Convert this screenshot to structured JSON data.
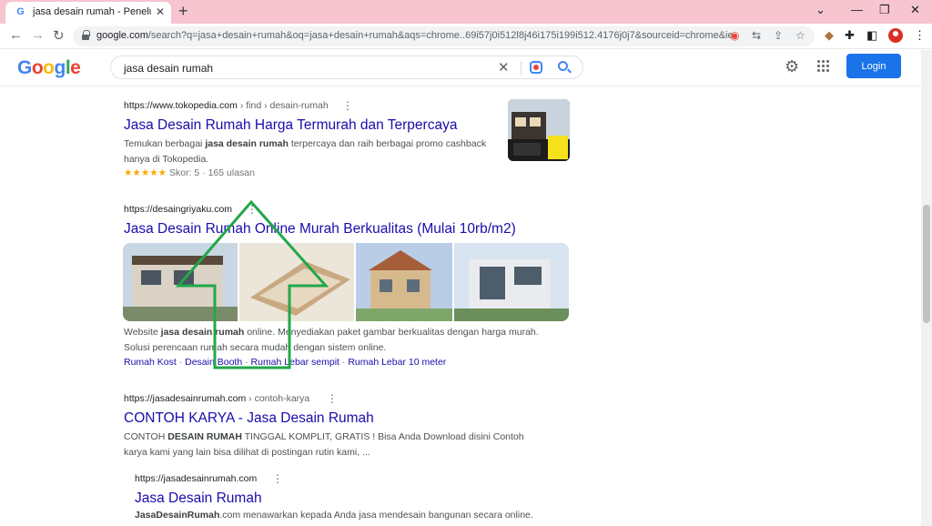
{
  "browser": {
    "tab_title": "jasa desain rumah - Penelusuran",
    "tab_close": "✕",
    "new_tab": "+",
    "url_host": "google.com",
    "url_path": "/search?q=jasa+desain+rumah&oq=jasa+desain+rumah&aqs=chrome..69i57j0i512l8j46i175i199i512.4176j0j7&sourceid=chrome&ie...",
    "win_min": "⌄",
    "win_minimize": "—",
    "win_restore": "❐",
    "win_close": "✕"
  },
  "google": {
    "logo_letters": [
      "G",
      "o",
      "o",
      "g",
      "l",
      "e"
    ],
    "logo_colors": [
      "#4285f4",
      "#ea4335",
      "#fbbc05",
      "#4285f4",
      "#34a853",
      "#ea4335"
    ],
    "query": "jasa desain rumah",
    "login_label": "Login"
  },
  "results": [
    {
      "cite": "https://www.tokopedia.com",
      "path": " › find › desain-rumah",
      "title": "Jasa Desain Rumah Harga Termurah dan Terpercaya",
      "snippet_a": "Temukan berbagai ",
      "snippet_b": "jasa desain rumah",
      "snippet_c": " terpercaya dan raih berbagai promo cashback",
      "snippet_d": "hanya di Tokopedia.",
      "stars": "★★★★★",
      "rating_text": " Skor: 5 · 165 ulasan"
    },
    {
      "cite": "https://desaingriyaku.com",
      "title": "Jasa Desain Rumah Online Murah Berkualitas (Mulai 10rb/m2)",
      "snippet_a": "Website ",
      "snippet_b": "jasa desain rumah",
      "snippet_c": " online. Menyediakan paket gambar berkualitas dengan harga murah.",
      "snippet_d": "Solusi perencaan rumah secara mudah dengan sistem online.",
      "sitelinks": [
        "Rumah Kost",
        "Desain Booth",
        "Rumah Lebar sempit",
        "Rumah Lebar 10 meter"
      ]
    },
    {
      "cite": "https://jasadesainrumah.com",
      "path": " › contoh-karya",
      "title": "CONTOH KARYA - Jasa Desain Rumah",
      "snippet_a": "CONTOH ",
      "snippet_b": "DESAIN RUMAH",
      "snippet_c": " TINGGAL KOMPLIT, GRATIS ! Bisa Anda Download disini Contoh",
      "snippet_d": "karya kami yang lain bisa dilihat di postingan rutin kami, ..."
    },
    {
      "cite": "https://jasadesainrumah.com",
      "title": "Jasa Desain Rumah",
      "snippet_b": "JasaDesainRumah",
      "snippet_c": ".com menawarkan kepada Anda jasa mendesain bangunan secara online."
    }
  ],
  "sitelink_sep": " · ",
  "kebab": "⋮"
}
